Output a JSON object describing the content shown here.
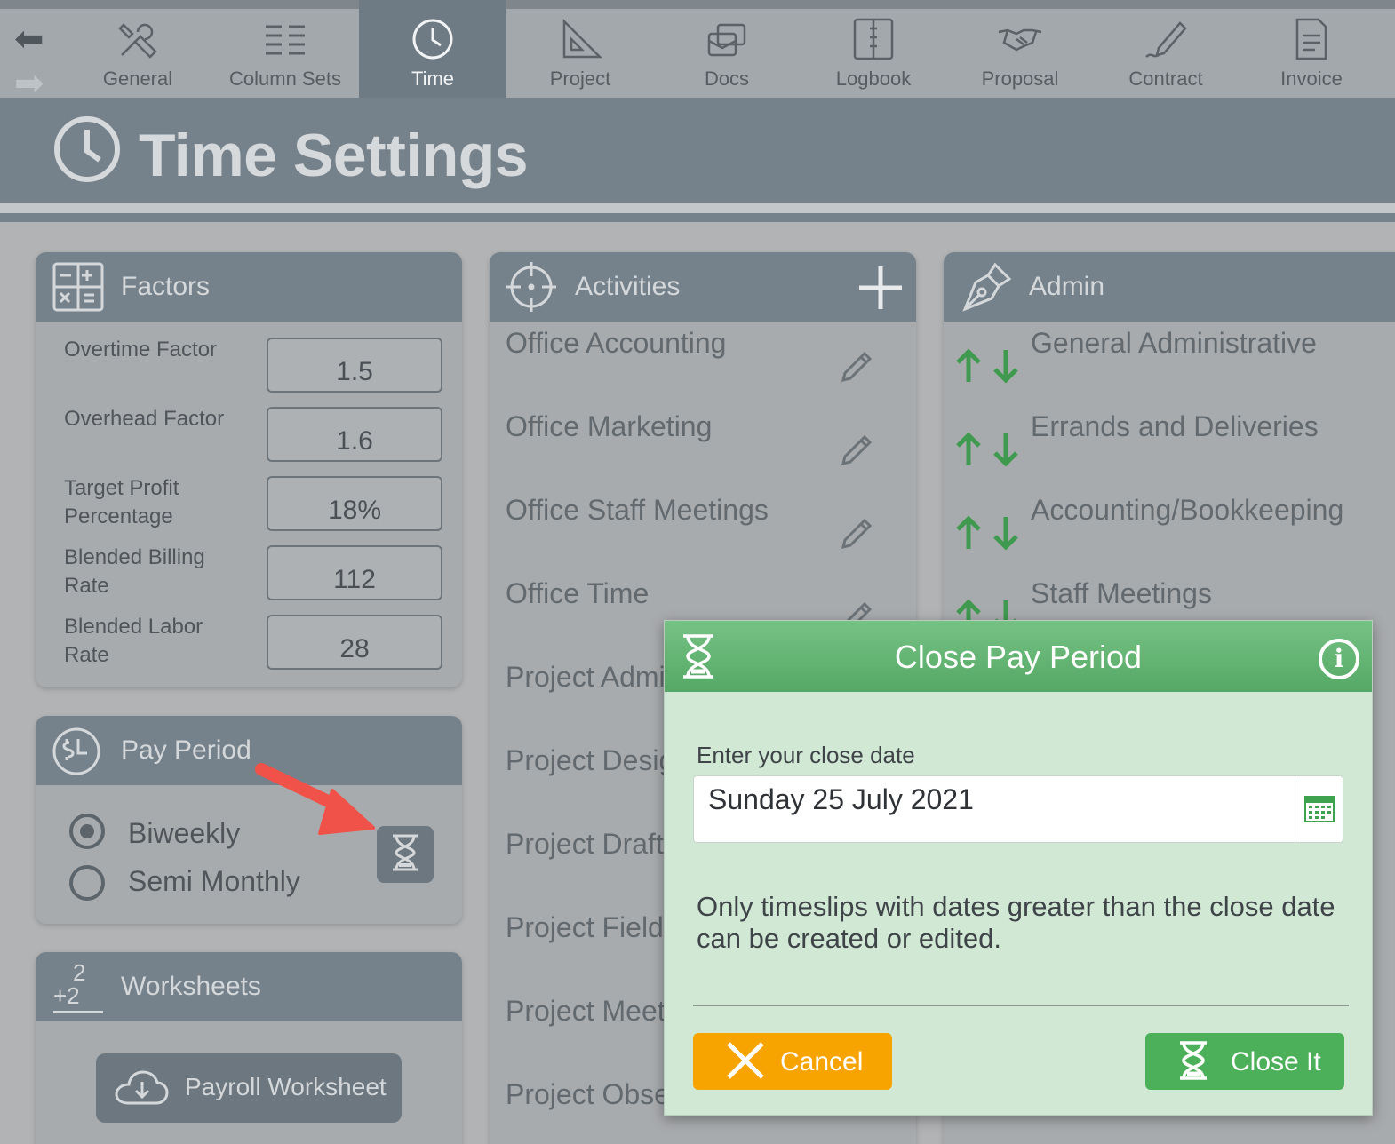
{
  "toolbar": {
    "tabs": [
      {
        "label": "General",
        "icon": "tools-icon"
      },
      {
        "label": "Column Sets",
        "icon": "columns-icon"
      },
      {
        "label": "Time",
        "icon": "clock-icon",
        "active": true
      },
      {
        "label": "Project",
        "icon": "triangle-ruler-icon"
      },
      {
        "label": "Docs",
        "icon": "docs-icon"
      },
      {
        "label": "Logbook",
        "icon": "logbook-icon"
      },
      {
        "label": "Proposal",
        "icon": "handshake-icon"
      },
      {
        "label": "Contract",
        "icon": "pen-signature-icon"
      },
      {
        "label": "Invoice",
        "icon": "invoice-icon"
      }
    ]
  },
  "header": {
    "title": "Time Settings"
  },
  "factors": {
    "title": "Factors",
    "rows": [
      {
        "label": "Overtime Factor",
        "value": "1.5"
      },
      {
        "label": "Overhead Factor",
        "value": "1.6"
      },
      {
        "label": "Target Profit Percentage",
        "value": "18%"
      },
      {
        "label": "Blended Billing Rate",
        "value": "112"
      },
      {
        "label": "Blended Labor Rate",
        "value": "28"
      }
    ]
  },
  "pay_period": {
    "title": "Pay Period",
    "options": [
      {
        "label": "Biweekly",
        "selected": true
      },
      {
        "label": "Semi Monthly",
        "selected": false
      }
    ]
  },
  "worksheets": {
    "title": "Worksheets",
    "icon_text_top": "2",
    "icon_text_bottom": "+2",
    "button_label": "Payroll Worksheet"
  },
  "activities": {
    "title": "Activities",
    "items": [
      "Office Accounting",
      "Office Marketing",
      "Office Staff Meetings",
      "Office Time",
      "Project Admi",
      "Project Desig",
      "Project Draft",
      "Project Field",
      "Project Meet",
      "Project Obse"
    ]
  },
  "admin": {
    "title": "Admin",
    "items": [
      "General Administrative",
      "Errands and Deliveries",
      "Accounting/Bookkeeping",
      "Staff Meetings"
    ]
  },
  "modal": {
    "title": "Close Pay Period",
    "info_glyph": "i",
    "field_label": "Enter your close date",
    "date_value": "Sunday 25 July 2021",
    "note": "Only timeslips with dates greater than the close date can be created or edited.",
    "cancel_label": "Cancel",
    "close_label": "Close It"
  },
  "colors": {
    "accent_green": "#4caf5a",
    "cancel_orange": "#f7a300",
    "header_slate": "#76828b",
    "annotation_red": "#f0524a"
  }
}
